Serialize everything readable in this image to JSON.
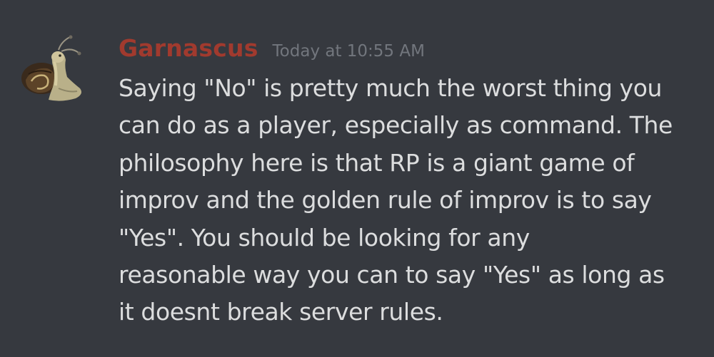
{
  "message": {
    "author": {
      "name": "Garnascus",
      "avatar_icon": "snail-avatar-icon",
      "name_color": "#a13a2e"
    },
    "timestamp": "Today at 10:55 AM",
    "content_lines": [
      "Saying \"No\" is pretty much the worst thing you",
      "can do as a player, especially as command. The",
      "philosophy here is that RP is a giant game of",
      "improv and the golden rule of improv is to say",
      "\"Yes\". You should be looking for any",
      "reasonable way you can to say \"Yes\" as long as",
      "it doesnt break server rules."
    ]
  },
  "colors": {
    "background": "#36393f",
    "text": "#dcddde",
    "timestamp": "#72767d"
  }
}
